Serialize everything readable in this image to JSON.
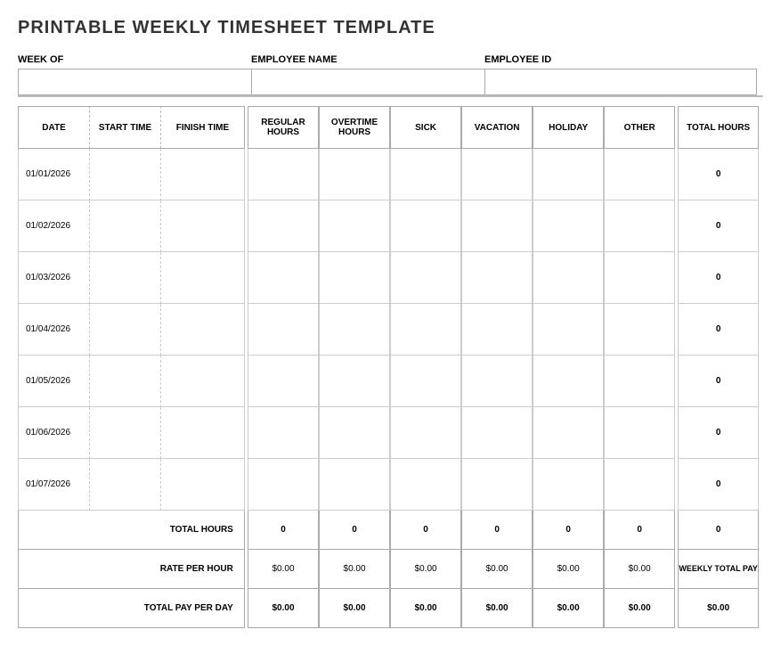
{
  "title": "PRINTABLE WEEKLY TIMESHEET TEMPLATE",
  "header": {
    "week_label": "WEEK OF",
    "employee_name_label": "EMPLOYEE NAME",
    "employee_id_label": "EMPLOYEE ID",
    "week_value": "",
    "employee_name_value": "",
    "employee_id_value": ""
  },
  "columns": {
    "date": "DATE",
    "start_time": "START TIME",
    "finish_time": "FINISH TIME",
    "regular_hours": "REGULAR HOURS",
    "overtime_hours": "OVERTIME HOURS",
    "sick": "SICK",
    "vacation": "VACATION",
    "holiday": "HOLIDAY",
    "other": "OTHER",
    "total_hours": "TOTAL HOURS"
  },
  "rows": [
    {
      "date": "01/01/2026",
      "start": "",
      "finish": "",
      "regular": "",
      "overtime": "",
      "sick": "",
      "vacation": "",
      "holiday": "",
      "other": "",
      "total": "0"
    },
    {
      "date": "01/02/2026",
      "start": "",
      "finish": "",
      "regular": "",
      "overtime": "",
      "sick": "",
      "vacation": "",
      "holiday": "",
      "other": "",
      "total": "0"
    },
    {
      "date": "01/03/2026",
      "start": "",
      "finish": "",
      "regular": "",
      "overtime": "",
      "sick": "",
      "vacation": "",
      "holiday": "",
      "other": "",
      "total": "0"
    },
    {
      "date": "01/04/2026",
      "start": "",
      "finish": "",
      "regular": "",
      "overtime": "",
      "sick": "",
      "vacation": "",
      "holiday": "",
      "other": "",
      "total": "0"
    },
    {
      "date": "01/05/2026",
      "start": "",
      "finish": "",
      "regular": "",
      "overtime": "",
      "sick": "",
      "vacation": "",
      "holiday": "",
      "other": "",
      "total": "0"
    },
    {
      "date": "01/06/2026",
      "start": "",
      "finish": "",
      "regular": "",
      "overtime": "",
      "sick": "",
      "vacation": "",
      "holiday": "",
      "other": "",
      "total": "0"
    },
    {
      "date": "01/07/2026",
      "start": "",
      "finish": "",
      "regular": "",
      "overtime": "",
      "sick": "",
      "vacation": "",
      "holiday": "",
      "other": "",
      "total": "0"
    }
  ],
  "summary": {
    "total_hours_label": "TOTAL HOURS",
    "total_hours": {
      "regular": "0",
      "overtime": "0",
      "sick": "0",
      "vacation": "0",
      "holiday": "0",
      "other": "0",
      "total": "0"
    },
    "rate_label": "RATE PER HOUR",
    "rate": {
      "regular": "$0.00",
      "overtime": "$0.00",
      "sick": "$0.00",
      "vacation": "$0.00",
      "holiday": "$0.00",
      "other": "$0.00"
    },
    "weekly_total_label": "WEEKLY TOTAL PAY",
    "pay_label": "TOTAL PAY PER DAY",
    "pay": {
      "regular": "$0.00",
      "overtime": "$0.00",
      "sick": "$0.00",
      "vacation": "$0.00",
      "holiday": "$0.00",
      "other": "$0.00",
      "total": "$0.00"
    }
  }
}
